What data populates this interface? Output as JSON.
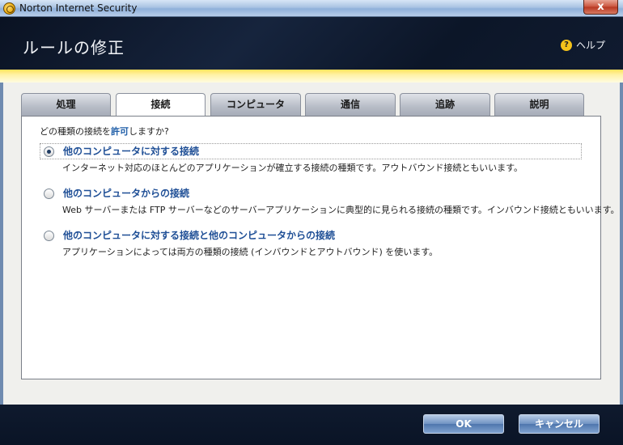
{
  "window": {
    "title": "Norton Internet Security",
    "close_label": "x"
  },
  "header": {
    "title": "ルールの修正",
    "help_label": "ヘルプ",
    "help_icon": "?"
  },
  "tabs": [
    "処理",
    "接続",
    "コンピュータ",
    "通信",
    "追跡",
    "説明"
  ],
  "active_tab": "接続",
  "question": {
    "prefix": "どの種類の接続を",
    "keyword": "許可",
    "suffix": "しますか?"
  },
  "options": [
    {
      "label": "他のコンピュータに対する接続",
      "description": "インターネット対応のほとんどのアプリケーションが確立する接続の種類です。アウトバウンド接続ともいいます。",
      "selected": true
    },
    {
      "label": "他のコンピュータからの接続",
      "description": "Web サーバーまたは FTP サーバーなどのサーバーアプリケーションに典型的に見られる接続の種類です。インバウンド接続ともいいます。",
      "selected": false
    },
    {
      "label": "他のコンピュータに対する接続と他のコンピュータからの接続",
      "description": "アプリケーションによっては両方の種類の接続 (インバウンドとアウトバウンド) を使います。",
      "selected": false
    }
  ],
  "buttons": {
    "ok": "OK",
    "cancel": "キャンセル"
  },
  "colors": {
    "accent": "#ffe35a",
    "header_bg": "#0c1628",
    "link_blue": "#1f4f96"
  }
}
